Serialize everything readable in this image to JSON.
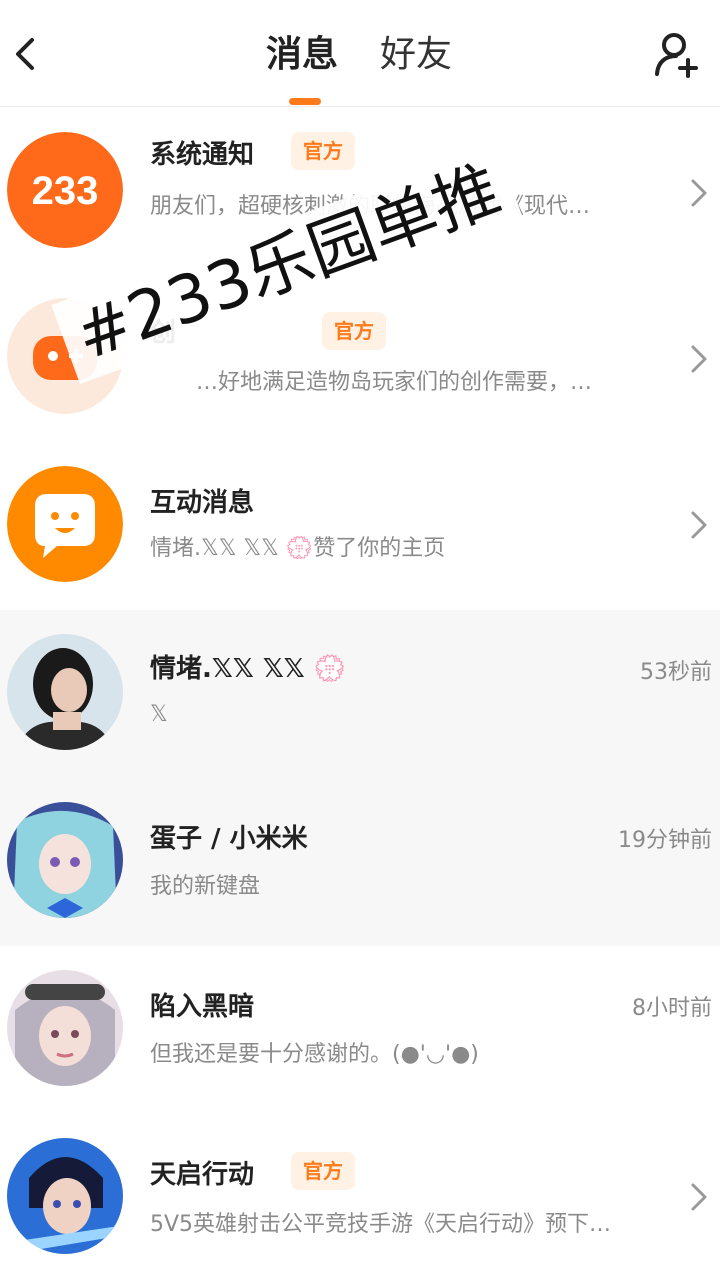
{
  "header": {
    "tab_messages": "消息",
    "tab_friends": "好友",
    "back_icon": "back-arrow-icon",
    "add_friend_icon": "add-user-icon",
    "accent_color": "#ff7a1a"
  },
  "items": [
    {
      "name": "系统通知",
      "badge": "官方",
      "preview": "朋友们，超硬核刺激的联机海战游戏《现代…",
      "avatar_text": "233",
      "chevron": true
    },
    {
      "name": "创",
      "badge": "官方",
      "preview": "…好地满足造物岛玩家们的创作需要，…",
      "chevron": true
    },
    {
      "name": "互动消息",
      "preview": "情堵.𝕏𝕏 𝕏𝕏 💮赞了你的主页",
      "chevron": true
    },
    {
      "name": "情堵.𝕏𝕏 𝕏𝕏 💮",
      "preview": "𝕏",
      "time": "53秒前"
    },
    {
      "name": "蛋子 / 小米米",
      "preview": "我的新键盘",
      "time": "19分钟前"
    },
    {
      "name": "陷入黑暗",
      "preview": "但我还是要十分感谢的。(●'◡'●)",
      "time": "8小时前"
    },
    {
      "name": "天启行动",
      "badge": "官方",
      "preview": "5V5英雄射击公平竞技手游《天启行动》预下…",
      "chevron": true
    }
  ],
  "watermark": "#233乐园单推"
}
